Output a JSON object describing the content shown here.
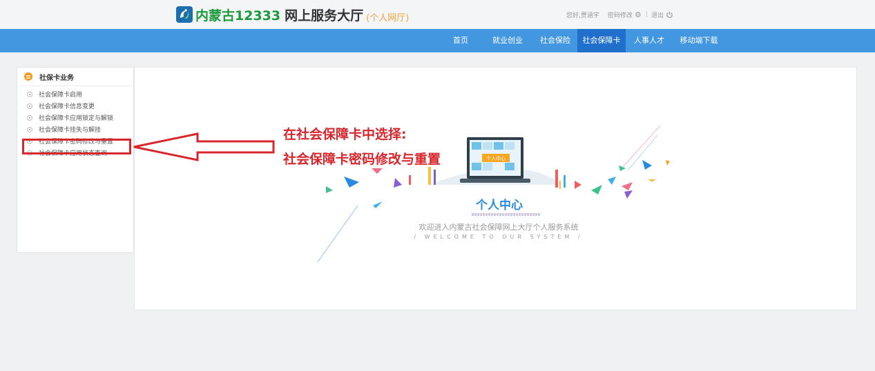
{
  "header": {
    "site_name": "内蒙古12333",
    "site_title": "网上服务大厅",
    "site_subtitle": "(个人网厅)",
    "greeting": "您好,贾涵宇",
    "password_change": "密码修改",
    "logout": "退出"
  },
  "nav": {
    "items": [
      {
        "label": "首页"
      },
      {
        "label": "就业创业"
      },
      {
        "label": "社会保险"
      },
      {
        "label": "社会保障卡"
      },
      {
        "label": "人事人才"
      },
      {
        "label": "移动端下载"
      }
    ],
    "active": "社会保障卡"
  },
  "sidebar": {
    "title": "社保卡业务",
    "items": [
      {
        "label": "社会保障卡启用"
      },
      {
        "label": "社会保障卡信息变更"
      },
      {
        "label": "社会保障卡应用锁定与解锁"
      },
      {
        "label": "社会保障卡挂失与解挂"
      },
      {
        "label": "社会保障卡密码修改与重置"
      },
      {
        "label": "社会保障卡应用状态查询"
      }
    ]
  },
  "annotation": {
    "line1": "在社会保障卡中选择:",
    "line2": "社会保障卡密码修改与重置"
  },
  "welcome": {
    "laptop_label": "个人中心",
    "title": "个人中心",
    "subtitle_cn": "欢迎进入内蒙古社会保障网上大厅个人服务系统",
    "subtitle_en": "/ WELCOME TO OUR SYSTEM /"
  },
  "colors": {
    "nav_bg": "#4297e0",
    "nav_active": "#1f6fcb",
    "logo_green": "#1a9a3b",
    "subtitle_orange": "#f0a43a",
    "annotation_red": "#d8262d",
    "welcome_blue": "#2a8adf"
  }
}
